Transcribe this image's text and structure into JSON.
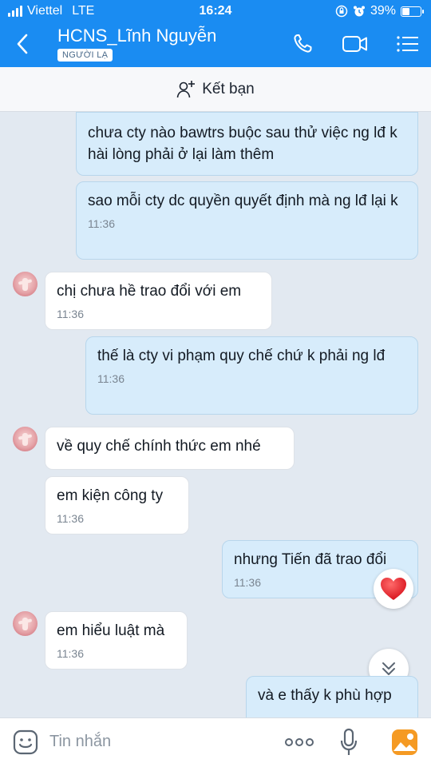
{
  "status": {
    "carrier": "Viettel",
    "network": "LTE",
    "time": "16:24",
    "battery": "39%",
    "battery_level": 0.39
  },
  "header": {
    "name": "HCNS_Lĩnh Nguyễn",
    "badge": "NGƯỜI LẠ"
  },
  "friend_bar": {
    "label": "Kết bạn"
  },
  "messages": [
    {
      "from": "me",
      "text": "chưa cty nào bawtrs buộc sau thử việc ng lđ k hài lòng phải ở lại làm thêm",
      "time": ""
    },
    {
      "from": "me",
      "text": "sao mỗi cty dc quyền quyết định mà ng lđ lại k",
      "time": "11:36"
    },
    {
      "from": "them",
      "text": "chị chưa hề trao đổi với em",
      "time": "11:36"
    },
    {
      "from": "me",
      "text": "thế là cty vi phạm quy chế chứ k phải ng lđ",
      "time": "11:36"
    },
    {
      "from": "them",
      "text": "về quy chế chính thức em nhé",
      "time": ""
    },
    {
      "from": "them",
      "text": "em kiện công ty",
      "time": "11:36"
    },
    {
      "from": "me",
      "text": "nhưng Tiến đã trao đổi",
      "time": "11:36"
    },
    {
      "from": "them",
      "text": "em hiểu luật mà",
      "time": "11:36"
    },
    {
      "from": "me",
      "text": "và e thấy k phù hợp",
      "time": ""
    }
  ],
  "input": {
    "placeholder": "Tin nhắn"
  },
  "colors": {
    "header": "#1a8cf2",
    "my_bubble": "#d7ecfb",
    "their_bubble": "#ffffff",
    "background": "#e2e9f1"
  }
}
